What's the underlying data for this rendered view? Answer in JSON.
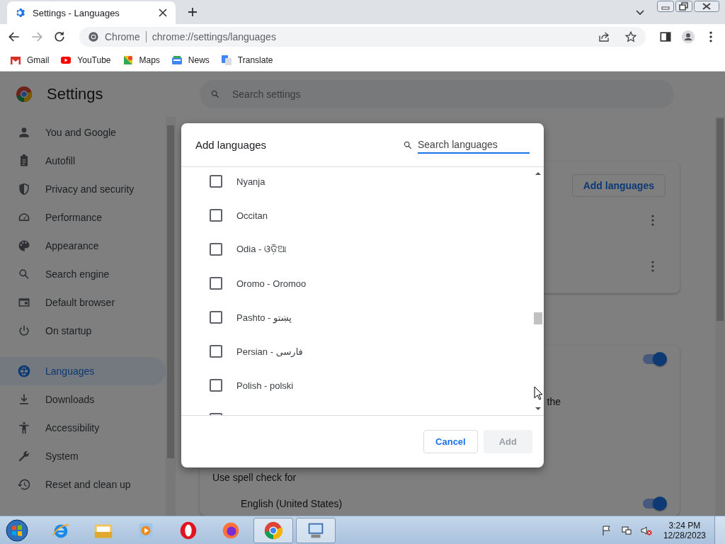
{
  "browser": {
    "tab": {
      "title": "Settings - Languages"
    },
    "omnibox": {
      "site_label": "Chrome",
      "url": "chrome://settings/languages"
    },
    "bookmarks": [
      {
        "label": "Gmail",
        "kind": "gmail"
      },
      {
        "label": "YouTube",
        "kind": "youtube"
      },
      {
        "label": "Maps",
        "kind": "maps"
      },
      {
        "label": "News",
        "kind": "news"
      },
      {
        "label": "Translate",
        "kind": "translate"
      }
    ]
  },
  "settings": {
    "title": "Settings",
    "search": {
      "placeholder": "Search settings"
    },
    "nav": [
      {
        "label": "You and Google",
        "kind": "person",
        "selected": false
      },
      {
        "label": "Autofill",
        "kind": "clipboard",
        "selected": false
      },
      {
        "label": "Privacy and security",
        "kind": "shield",
        "selected": false
      },
      {
        "label": "Performance",
        "kind": "gauge",
        "selected": false
      },
      {
        "label": "Appearance",
        "kind": "palette",
        "selected": false
      },
      {
        "label": "Search engine",
        "kind": "search",
        "selected": false
      },
      {
        "label": "Default browser",
        "kind": "browser",
        "selected": false
      },
      {
        "label": "On startup",
        "kind": "power",
        "selected": false
      },
      {
        "label": "Languages",
        "kind": "globe",
        "selected": true
      },
      {
        "label": "Downloads",
        "kind": "download",
        "selected": false
      },
      {
        "label": "Accessibility",
        "kind": "accessibility",
        "selected": false
      },
      {
        "label": "System",
        "kind": "wrench",
        "selected": false
      },
      {
        "label": "Reset and clean up",
        "kind": "history",
        "selected": false
      }
    ],
    "main": {
      "add_languages_button": "Add languages",
      "top_toggle": {
        "on": true
      },
      "fragment": "the",
      "spell_check_label": "Use spell check for",
      "spell_language": {
        "label": "English (United States)",
        "on": true
      }
    }
  },
  "dialog": {
    "title": "Add languages",
    "search": {
      "placeholder": "Search languages"
    },
    "languages": [
      {
        "label": "Nyanja",
        "checked": false
      },
      {
        "label": "Occitan",
        "checked": false
      },
      {
        "label": "Odia - ଓଡ଼ିଆ",
        "checked": false
      },
      {
        "label": "Oromo - Oromoo",
        "checked": false
      },
      {
        "label": "Pashto - پښتو",
        "checked": false
      },
      {
        "label": "Persian - فارسی",
        "checked": false
      },
      {
        "label": "Polish - polski",
        "checked": false
      }
    ],
    "cancel_button": {
      "label": "Cancel"
    },
    "add_button": {
      "label": "Add",
      "disabled": true
    }
  },
  "taskbar": {
    "apps": [
      {
        "kind": "ie",
        "active": false
      },
      {
        "kind": "explorer",
        "active": false
      },
      {
        "kind": "media",
        "active": false
      },
      {
        "kind": "opera",
        "active": false
      },
      {
        "kind": "firefox",
        "active": false
      },
      {
        "kind": "chrome",
        "active": true
      },
      {
        "kind": "remote",
        "active": true
      }
    ],
    "time": "3:24 PM",
    "date": "12/28/2023"
  }
}
